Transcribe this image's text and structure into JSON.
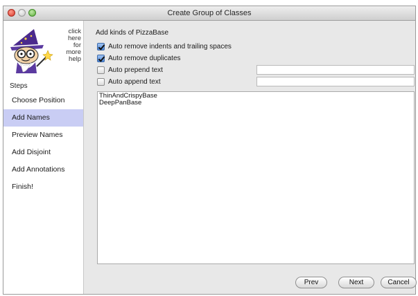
{
  "window": {
    "title": "Create Group of Classes"
  },
  "sidebar": {
    "help_link": "click here for more help",
    "steps_label": "Steps",
    "steps": [
      {
        "label": "Choose Position",
        "active": false
      },
      {
        "label": "Add Names",
        "active": true
      },
      {
        "label": "Preview Names",
        "active": false
      },
      {
        "label": "Add Disjoint",
        "active": false
      },
      {
        "label": "Add Annotations",
        "active": false
      },
      {
        "label": "Finish!",
        "active": false
      }
    ]
  },
  "main": {
    "heading": "Add kinds of PizzaBase",
    "options": [
      {
        "label": "Auto remove indents and trailing spaces",
        "checked": true
      },
      {
        "label": "Auto remove duplicates",
        "checked": true
      },
      {
        "label": "Auto prepend text",
        "checked": false,
        "value": ""
      },
      {
        "label": "Auto append text",
        "checked": false,
        "value": ""
      }
    ],
    "names": [
      "ThinAndCrispyBase",
      "DeepPanBase"
    ]
  },
  "buttons": {
    "prev": "Prev",
    "next": "Next",
    "cancel": "Cancel"
  },
  "colors": {
    "active_step": "#c9cdf4",
    "close_light": "#d6372a",
    "zoom_light": "#5fae3d"
  },
  "icons": [
    "close-light",
    "minimize-light",
    "zoom-light",
    "wizard-icon",
    "checkbox-checked-icon"
  ]
}
